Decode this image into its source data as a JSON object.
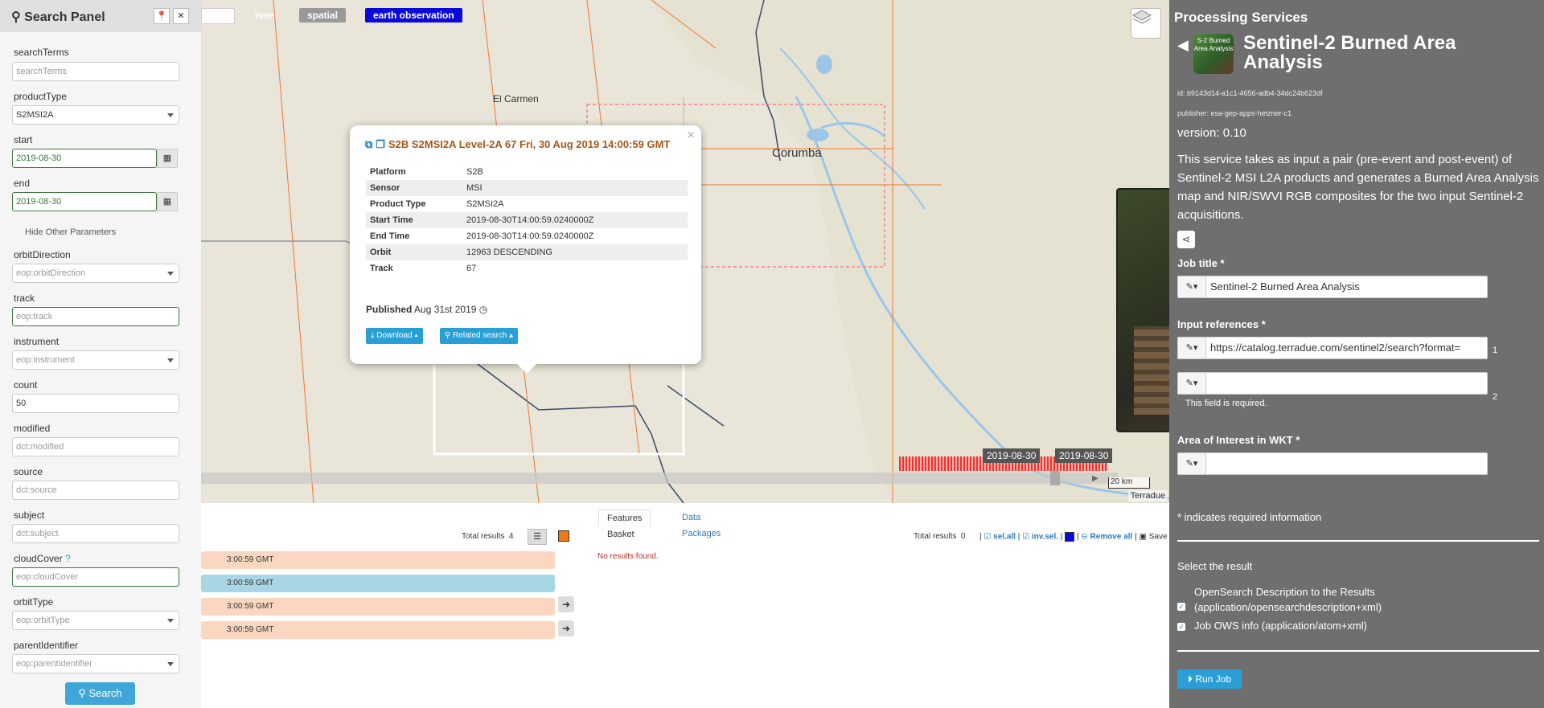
{
  "map": {
    "tags": [
      {
        "label": "time",
        "color": "#f0932b"
      },
      {
        "label": "spatial",
        "color": "#999999"
      },
      {
        "label": "earth observation",
        "color": "#0a0ad8"
      }
    ],
    "places": [
      "El Carmen",
      "Corumba"
    ],
    "scale": "20 km",
    "attribution": "Terradue",
    "timeline_dates": [
      "2019-08-30",
      "2019-08-30"
    ]
  },
  "popup": {
    "title": "S2B S2MSI2A Level-2A 67 Fri, 30 Aug 2019 14:00:59 GMT",
    "rows": [
      {
        "k": "Platform",
        "v": "S2B"
      },
      {
        "k": "Sensor",
        "v": "MSI"
      },
      {
        "k": "Product Type",
        "v": "S2MSI2A"
      },
      {
        "k": "Start Time",
        "v": "2019-08-30T14:00:59.0240000Z"
      },
      {
        "k": "End Time",
        "v": "2019-08-30T14:00:59.0240000Z"
      },
      {
        "k": "Orbit",
        "v": "12963 DESCENDING"
      },
      {
        "k": "Track",
        "v": "67"
      }
    ],
    "published_label": "Published",
    "published_value": "Aug 31st 2019",
    "download_label": "Download",
    "related_label": "Related search"
  },
  "search": {
    "title": "Search Panel",
    "hide_params": "Hide Other Parameters",
    "button": "Search",
    "fields": {
      "searchTerms": {
        "label": "searchTerms",
        "placeholder": "searchTerms"
      },
      "productType": {
        "label": "productType",
        "value": "S2MSI2A"
      },
      "start": {
        "label": "start",
        "value": "2019-08-30"
      },
      "end": {
        "label": "end",
        "value": "2019-08-30"
      },
      "orbitDirection": {
        "label": "orbitDirection",
        "placeholder": "eop:orbitDirection"
      },
      "track": {
        "label": "track",
        "placeholder": "eop:track"
      },
      "instrument": {
        "label": "instrument",
        "placeholder": "eop:instrument"
      },
      "count": {
        "label": "count",
        "value": "50"
      },
      "modified": {
        "label": "modified",
        "placeholder": "dct:modified"
      },
      "source": {
        "label": "source",
        "placeholder": "dct:source"
      },
      "subject": {
        "label": "subject",
        "placeholder": "dct:subject"
      },
      "cloudCover": {
        "label": "cloudCover",
        "placeholder": "eop:cloudCover"
      },
      "orbitType": {
        "label": "orbitType",
        "placeholder": "eop:orbitType"
      },
      "parentIdentifier": {
        "label": "parentIdentifier",
        "placeholder": "eop:parentIdentifier"
      }
    }
  },
  "results": {
    "total_label": "Total results",
    "total": "4",
    "rows": [
      "3:00:59 GMT",
      "3:00:59 GMT",
      "3:00:59 GMT",
      "3:00:59 GMT"
    ],
    "tabs": [
      "Features Basket",
      "Data Packages"
    ],
    "basket_total_label": "Total results",
    "basket_total": "0",
    "sel_all": "sel.all",
    "inv_sel": "inv.sel.",
    "remove_all": "Remove all",
    "save": "Save",
    "no_results": "No results found."
  },
  "processing": {
    "header": "Processing Services",
    "icon_text": "S-2 Burned Area Analysis",
    "title": "Sentinel-2 Burned Area Analysis",
    "id": "id: b9143d14-a1c1-4656-adb4-34dc24b623df",
    "publisher": "publisher: esa-gep-apps-hetzner-c1",
    "version": "version: 0.10",
    "description": "This service takes as input a pair (pre-event and post-event) of Sentinel-2 MSI L2A products and generates a Burned Area Analysis map and NIR/SWVI RGB composites for the two input Sentinel-2 acquisitions.",
    "job_title_label": "Job title *",
    "job_title_value": "Sentinel-2 Burned Area Analysis",
    "input_refs_label": "Input references *",
    "input_ref_1": "https://catalog.terradue.com/sentinel2/search?format=",
    "input_ref_2": "",
    "num_1": "1",
    "num_2": "2",
    "required_msg": "This field is required.",
    "aoi_label": "Area of Interest in WKT *",
    "aoi_value": "",
    "required_note": "* indicates required information",
    "select_result": "Select the result",
    "opt1_line1": "OpenSearch Description to the Results",
    "opt1_line2": "(application/opensearchdescription+xml)",
    "opt2": "Job OWS info (application/atom+xml)",
    "run": "Run Job"
  }
}
